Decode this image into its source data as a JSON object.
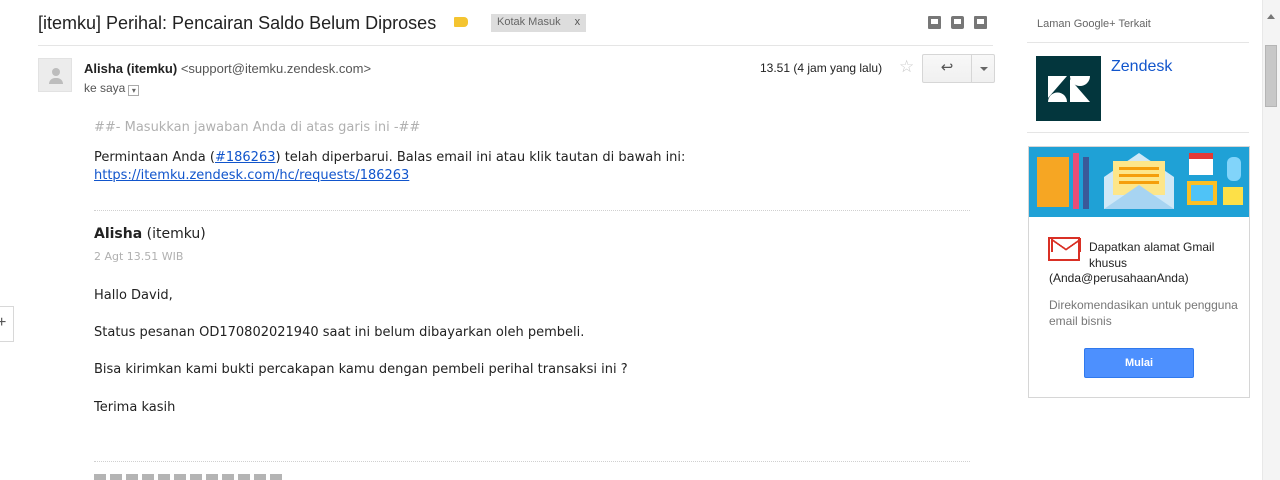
{
  "header": {
    "subject": "[itemku] Perihal: Pencairan Saldo Belum Diproses",
    "label_icon": "label-tag-icon",
    "label_color": "#f4c430",
    "inbox_chip": "Kotak Masuk",
    "inbox_chip_remove": "x",
    "toolbar_icons": [
      "download-icon",
      "print-icon",
      "new-window-icon"
    ]
  },
  "sender": {
    "name": "Alisha (itemku)",
    "email": "<support@itemku.zendesk.com>",
    "recipient": "ke saya",
    "time": "13.51 (4 jam yang lalu)",
    "star": "☆",
    "reply_icon": "↩"
  },
  "body": {
    "reply_line": "##- Masukkan jawaban Anda di atas garis ini -##",
    "request_prefix": "Permintaan Anda (",
    "request_link": "#186263",
    "request_suffix": ") telah diperbarui. Balas email ini atau klik tautan di bawah ini:",
    "request_url": "https://itemku.zendesk.com/hc/requests/186263",
    "author_name": "Alisha",
    "author_org": "(itemku)",
    "date": "2 Agt 13.51 WIB",
    "p1": "Hallo David,",
    "p2": "Status pesanan OD170802021940 saat ini belum dibayarkan oleh pembeli.",
    "p3": "Bisa kirimkan kami bukti percakapan kamu dengan pembeli perihal transaksi ini ?",
    "p4": "Terima kasih"
  },
  "sidebar": {
    "title": "Laman Google+ Terkait",
    "company": "Zendesk",
    "logo_color": "#03363d",
    "promo_head": "Dapatkan alamat Gmail khusus",
    "promo_head2": "(Anda@perusahaanAnda)",
    "promo_sub": "Direkomendasikan untuk pengguna email bisnis",
    "cta": "Mulai",
    "banner_color": "#1fa1d6"
  }
}
